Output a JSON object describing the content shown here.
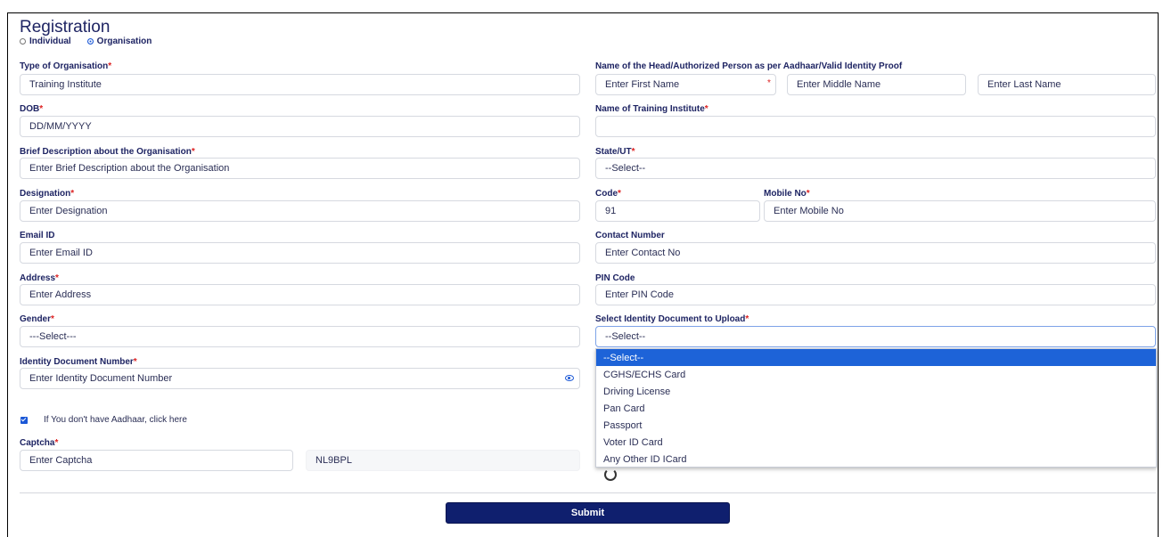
{
  "title": "Registration",
  "entity_type": {
    "options": [
      "Individual",
      "Organisation"
    ],
    "selected": "Organisation"
  },
  "required_mark": "*",
  "left": {
    "type_label": "Type of Organisation",
    "type_value": "Training Institute",
    "dob_label": "DOB",
    "dob_placeholder": "DD/MM/YYYY",
    "desc_label": "Brief Description about the Organisation",
    "desc_placeholder": "Enter Brief Description about the Organisation",
    "designation_label": "Designation",
    "designation_placeholder": "Enter Designation",
    "email_label": "Email ID",
    "email_placeholder": "Enter Email ID",
    "address_label": "Address",
    "address_placeholder": "Enter Address",
    "gender_label": "Gender",
    "gender_value": "---Select---",
    "iddoc_label": "Identity Document Number",
    "iddoc_placeholder": "Enter Identity Document Number",
    "aadhaar_checkbox_label": "If You don't have Aadhaar, click here",
    "captcha_label": "Captcha",
    "captcha_placeholder": "Enter Captcha",
    "captcha_code": "NL9BPL"
  },
  "right": {
    "head_label": "Name of the Head/Authorized Person as per Aadhaar/Valid Identity Proof",
    "first_name_placeholder": "Enter First Name",
    "middle_name_placeholder": "Enter Middle Name",
    "last_name_placeholder": "Enter Last Name",
    "institute_label": "Name of Training Institute",
    "institute_value": "",
    "state_label": "State/UT",
    "state_value": "--Select--",
    "code_label": "Code",
    "code_value": "91",
    "mobile_label": "Mobile No",
    "mobile_placeholder": "Enter Mobile No",
    "contact_label": "Contact Number",
    "contact_placeholder": "Enter Contact No",
    "pin_label": "PIN Code",
    "pin_placeholder": "Enter PIN Code",
    "idupload_label": "Select Identity Document to Upload",
    "idupload_value": "--Select--",
    "idupload_options": [
      "--Select--",
      "CGHS/ECHS Card",
      "Driving License",
      "Pan Card",
      "Passport",
      "Voter ID Card",
      "Any Other ID ICard"
    ]
  },
  "submit_label": "Submit",
  "colors": {
    "accent": "#1d63d8",
    "button": "#0f1f6e",
    "text": "#1e2463",
    "required": "#dd2222"
  }
}
